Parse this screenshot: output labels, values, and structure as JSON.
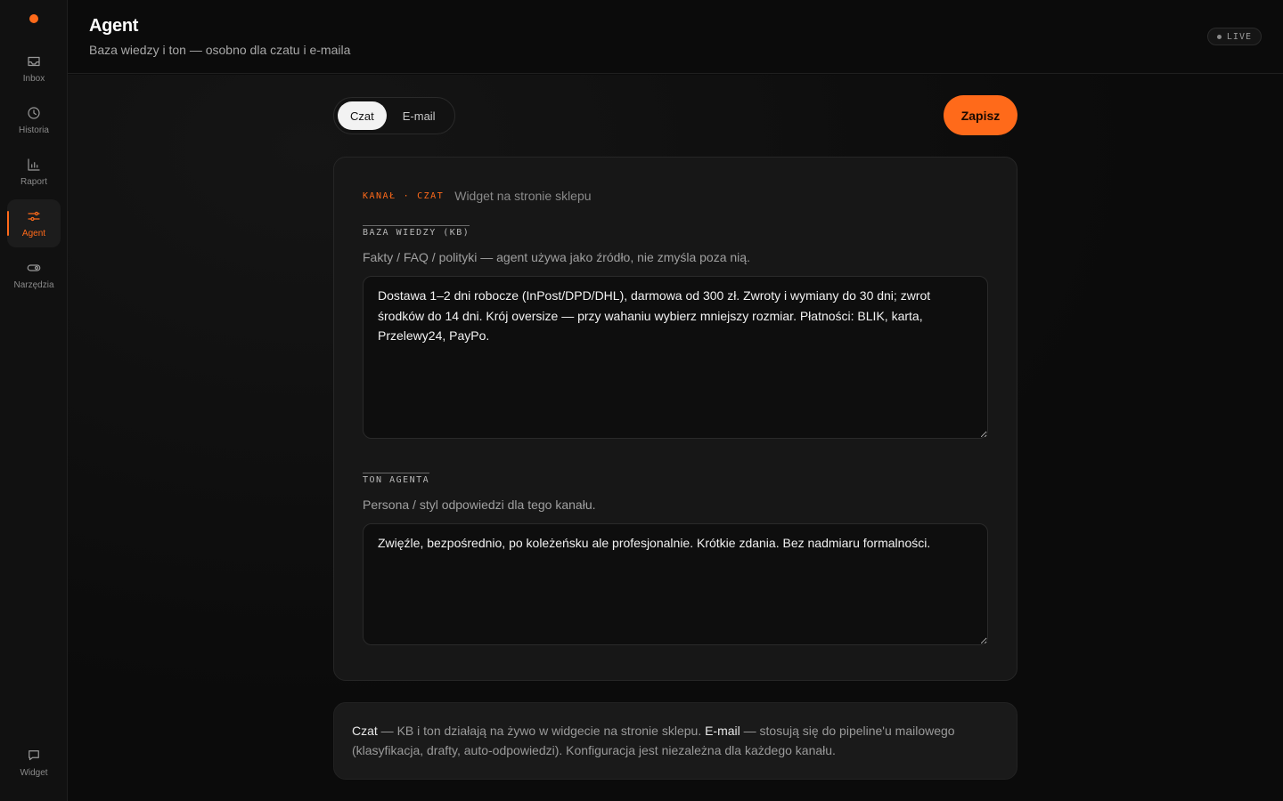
{
  "sidebar": {
    "items": [
      {
        "label": "Inbox",
        "icon": "inbox-icon"
      },
      {
        "label": "Historia",
        "icon": "clock-icon"
      },
      {
        "label": "Raport",
        "icon": "bar-chart-icon"
      },
      {
        "label": "Agent",
        "icon": "sliders-icon",
        "active": true
      },
      {
        "label": "Narzędzia",
        "icon": "toggle-icon"
      }
    ],
    "bottom_item": {
      "label": "Widget",
      "icon": "chat-bubble-icon"
    }
  },
  "header": {
    "title": "Agent",
    "subtitle": "Baza wiedzy i ton — osobno dla czatu i e-maila",
    "status_badge": "LIVE"
  },
  "tabs": [
    {
      "label": "Czat",
      "active": true
    },
    {
      "label": "E-mail",
      "active": false
    }
  ],
  "save_label": "Zapisz",
  "card": {
    "channel_prefix": "KANAŁ",
    "channel_sep": "·",
    "channel_name": "CZAT",
    "channel_desc": "Widget na stronie sklepu",
    "kb": {
      "label": "BAZA WIEDZY (KB)",
      "help": "Fakty / FAQ / polityki — agent używa jako źródło, nie zmyśla poza nią.",
      "value": "Dostawa 1–2 dni robocze (InPost/DPD/DHL), darmowa od 300 zł. Zwroty i wymiany do 30 dni; zwrot środków do 14 dni. Krój oversize — przy wahaniu wybierz mniejszy rozmiar. Płatności: BLIK, karta, Przelewy24, PayPo."
    },
    "tone": {
      "label": "TON AGENTA",
      "help": "Persona / styl odpowiedzi dla tego kanału.",
      "value": "Zwięźle, bezpośrednio, po koleżeńsku ale profesjonalnie. Krótkie zdania. Bez nadmiaru formalności."
    }
  },
  "info": {
    "czat_label": "Czat",
    "czat_text": " — KB i ton działają na żywo w widgecie na stronie sklepu. ",
    "email_label": "E-mail",
    "email_text": " — stosują się do pipeline'u mailowego (klasyfikacja, drafty, auto-odpowiedzi). Konfiguracja jest niezależna dla każdego kanału."
  },
  "colors": {
    "accent": "#ff6a1a",
    "background": "#0b0b0b",
    "card": "#171717"
  }
}
